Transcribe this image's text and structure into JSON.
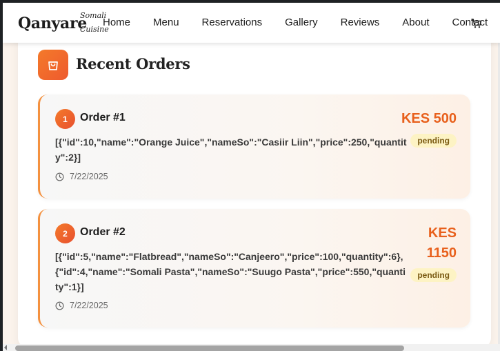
{
  "brand": {
    "name": "Qanyare",
    "sub_line1": "Somali",
    "sub_line2": "Cuisine"
  },
  "nav": {
    "items": [
      {
        "label": "Home"
      },
      {
        "label": "Menu"
      },
      {
        "label": "Reservations"
      },
      {
        "label": "Gallery"
      },
      {
        "label": "Reviews"
      },
      {
        "label": "About"
      },
      {
        "label": "Contact"
      }
    ],
    "cart_icon": "shopping-cart-icon"
  },
  "section": {
    "title": "Recent Orders",
    "icon": "shopping-bag-icon"
  },
  "orders": [
    {
      "number": "1",
      "title": "Order #1",
      "items": "[{\"id\":10,\"name\":\"Orange Juice\",\"nameSo\":\"Casiir Liin\",\"price\":250,\"quantity\":2}]",
      "date": "7/22/2025",
      "price": "KES 500",
      "status": "pending"
    },
    {
      "number": "2",
      "title": "Order #2",
      "items": "[{\"id\":5,\"name\":\"Flatbread\",\"nameSo\":\"Canjeero\",\"price\":100,\"quantity\":6},{\"id\":4,\"name\":\"Somali Pasta\",\"nameSo\":\"Suugo Pasta\",\"price\":550,\"quantity\":1}]",
      "date": "7/22/2025",
      "price": "KES 1150",
      "status": "pending"
    }
  ],
  "colors": {
    "accent": "#e8601c",
    "pending_bg": "#fdf3c4",
    "pending_text": "#7a5a12"
  }
}
